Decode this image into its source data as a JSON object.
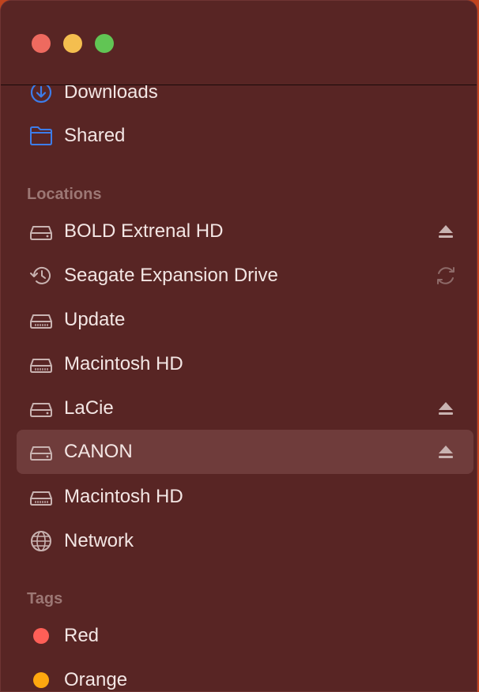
{
  "window": {
    "traffic_lights": [
      {
        "name": "close",
        "color": "#ee6a5f"
      },
      {
        "name": "minimize",
        "color": "#f4be4f"
      },
      {
        "name": "zoom",
        "color": "#61c554"
      }
    ]
  },
  "favorites": [
    {
      "label": "Downloads",
      "icon": "download-circle-icon"
    },
    {
      "label": "Shared",
      "icon": "folder-icon"
    }
  ],
  "locations": {
    "heading": "Locations",
    "items": [
      {
        "label": "BOLD Extrenal HD",
        "icon": "external-drive-icon",
        "trailing": "eject-icon"
      },
      {
        "label": "Seagate Expansion Drive",
        "icon": "time-machine-icon",
        "trailing": "sync-icon"
      },
      {
        "label": "Update",
        "icon": "internal-drive-icon"
      },
      {
        "label": "Macintosh HD",
        "icon": "internal-drive-icon"
      },
      {
        "label": "LaCie",
        "icon": "external-drive-icon",
        "trailing": "eject-icon"
      },
      {
        "label": "CANON",
        "icon": "external-drive-icon",
        "trailing": "eject-icon",
        "selected": true
      },
      {
        "label": "Macintosh HD",
        "icon": "internal-drive-icon"
      },
      {
        "label": "Network",
        "icon": "globe-icon"
      }
    ]
  },
  "tags": {
    "heading": "Tags",
    "items": [
      {
        "label": "Red",
        "color": "#ff5f57"
      },
      {
        "label": "Orange",
        "color": "#ffa70f"
      }
    ]
  }
}
